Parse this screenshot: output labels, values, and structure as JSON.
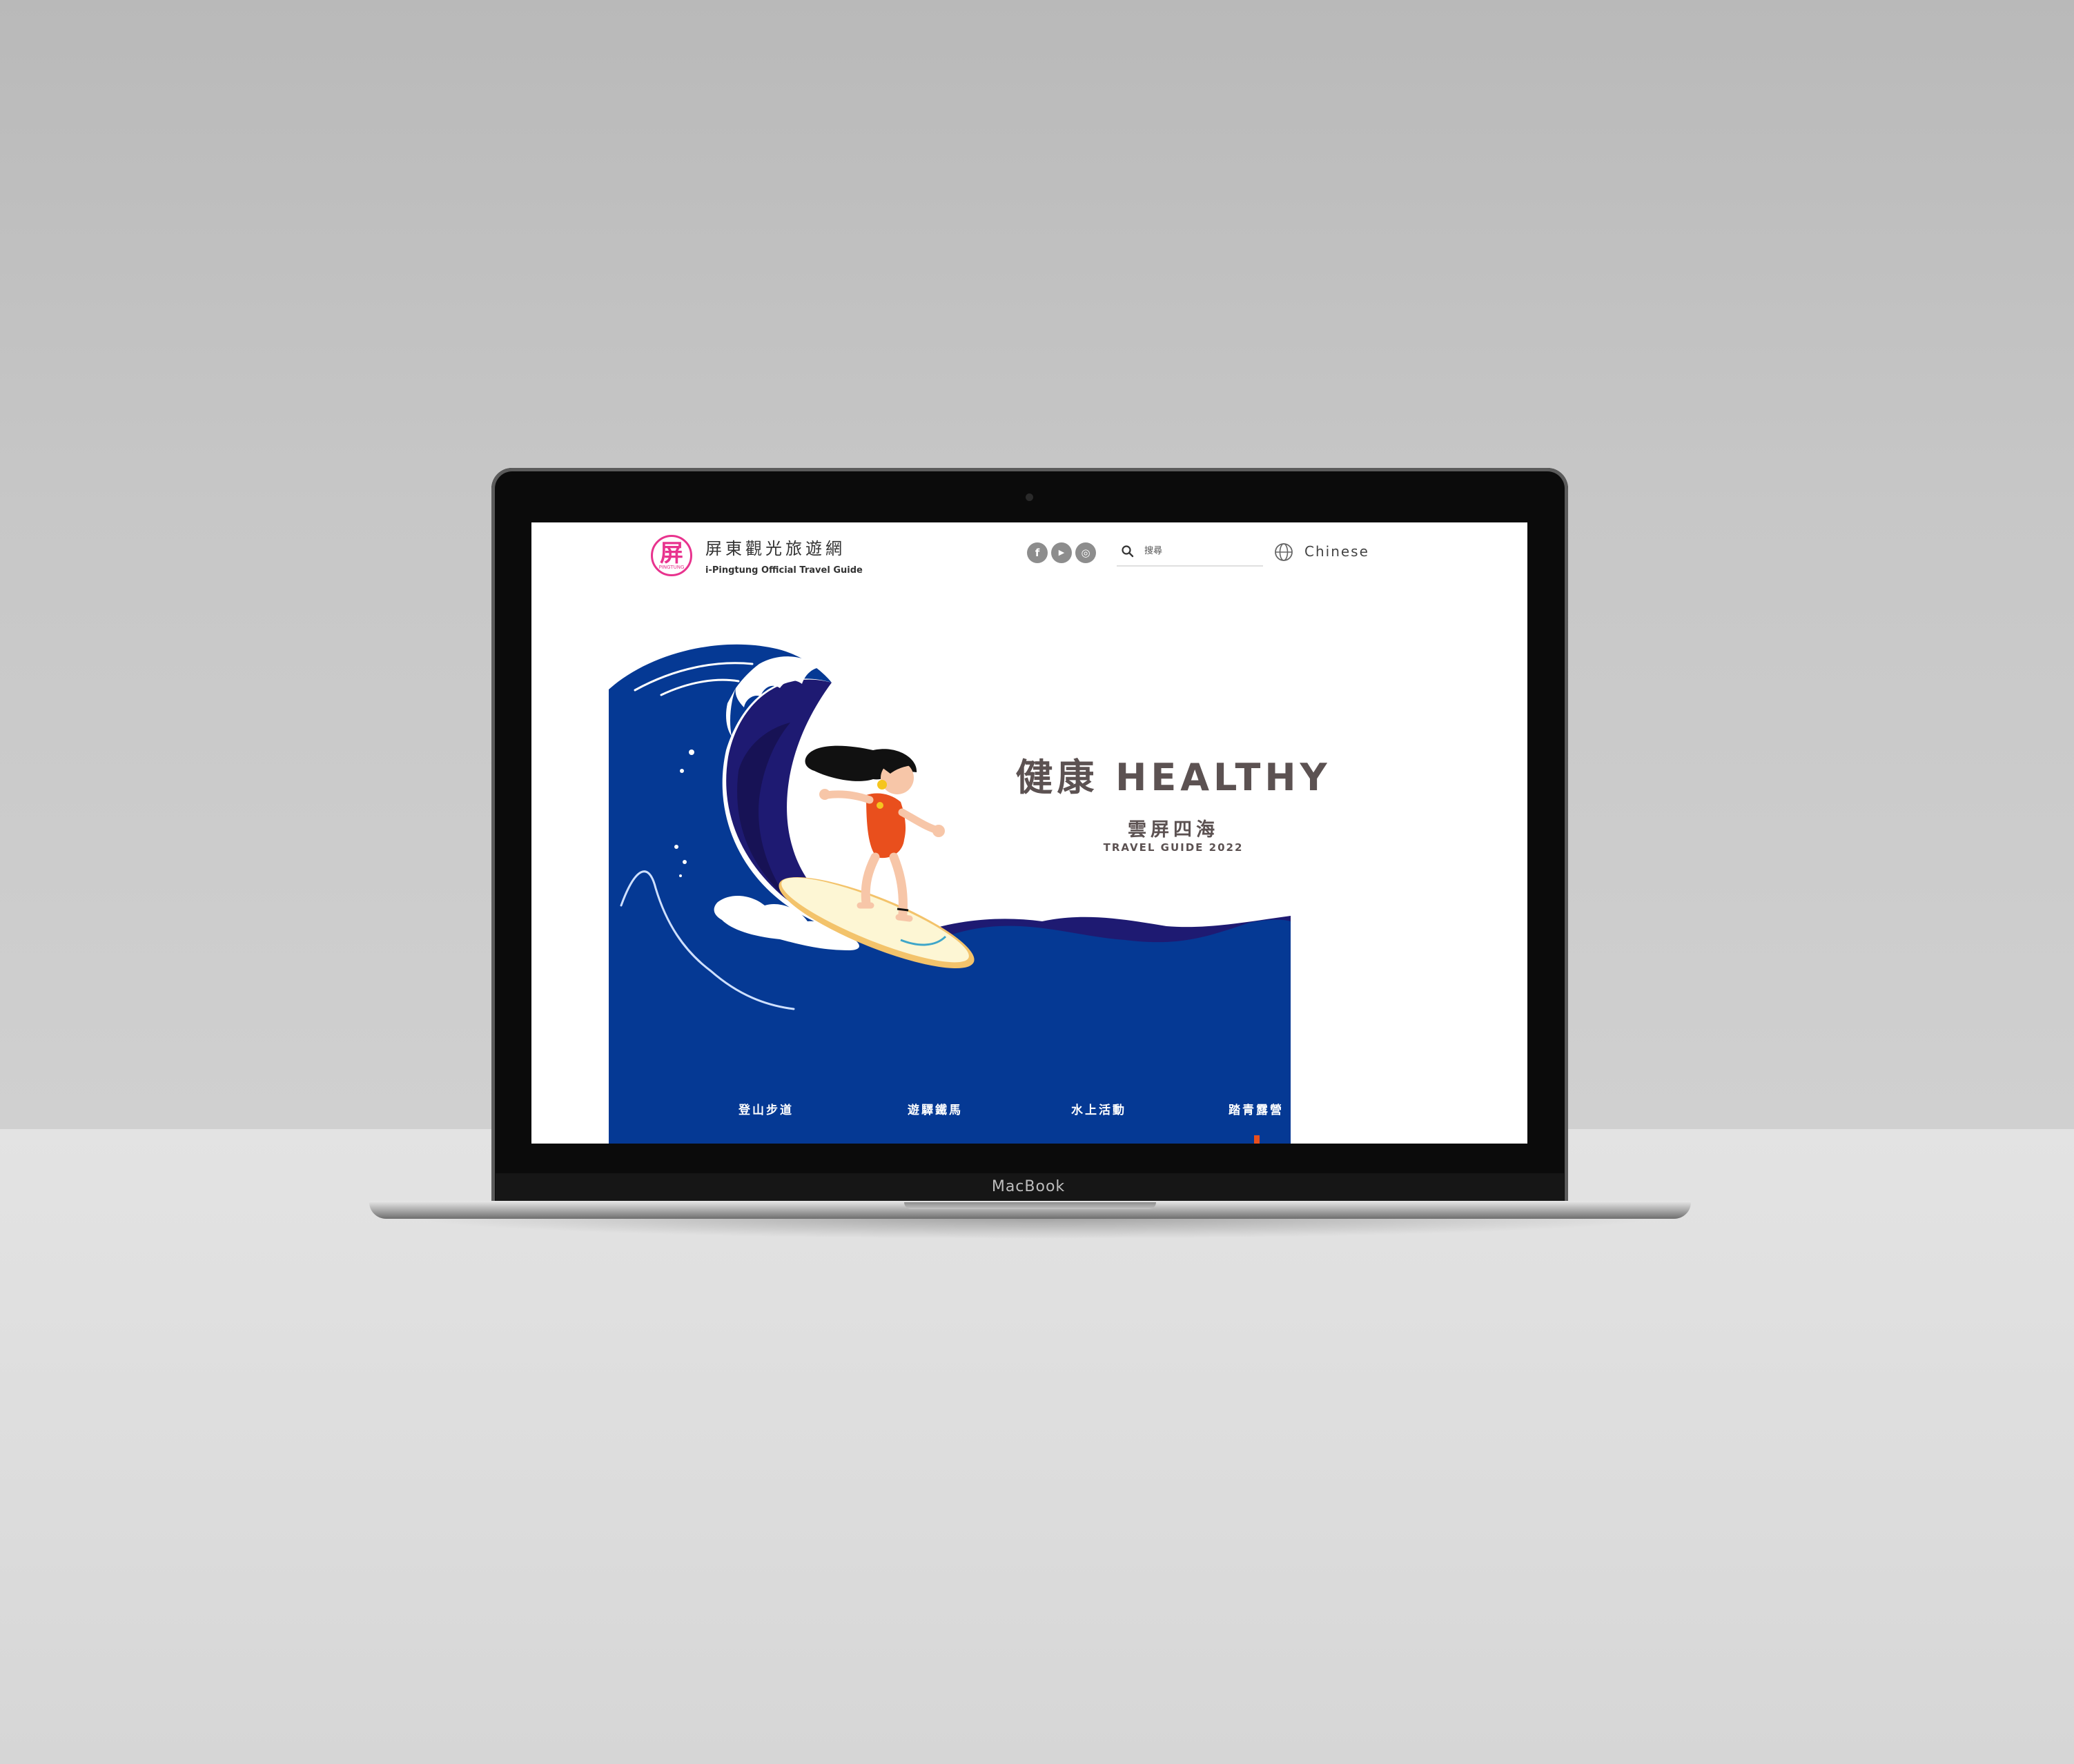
{
  "device": {
    "brand_label": "MacBook"
  },
  "header": {
    "logo_char": "屏",
    "logo_sub": "PINGTUNG",
    "site_title": "屏東觀光旅遊網",
    "site_subtitle": "i-Pingtung Official  Travel Guide",
    "social": [
      {
        "name": "facebook",
        "glyph": "f"
      },
      {
        "name": "youtube",
        "glyph": "▶"
      },
      {
        "name": "instagram",
        "glyph": "◎"
      }
    ],
    "search": {
      "placeholder": "搜尋"
    },
    "language": "Chinese"
  },
  "hero": {
    "title": "健康 HEALTHY",
    "subtitle": "雲屏四海",
    "tag": "TRAVEL GUIDE 2022"
  },
  "categories": [
    "登山步道",
    "遊驛鐵馬",
    "水上活動",
    "踏青露營"
  ],
  "colors": {
    "wave_blue": "#053994",
    "wave_dark": "#1e1a72",
    "accent_pink": "#e8338e",
    "accent_orange": "#e94f1d",
    "text_gray": "#5c5252"
  }
}
